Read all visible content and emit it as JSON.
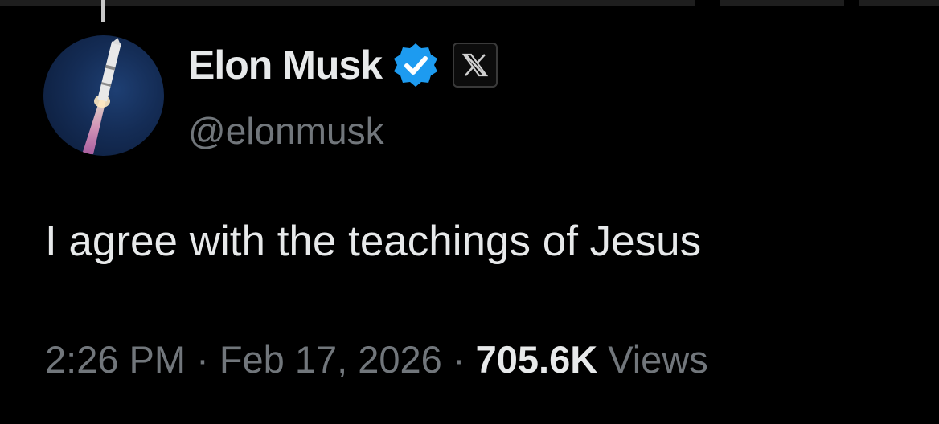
{
  "author": {
    "display_name": "Elon Musk",
    "handle": "@elonmusk",
    "verified": true,
    "affiliate_badge": "x-logo-icon",
    "avatar": "rocket-launch-avatar"
  },
  "tweet": {
    "text": "I agree with the teachings of Jesus",
    "time": "2:26 PM",
    "separator": "·",
    "date": "Feb 17, 2026",
    "views_count": "705.6K",
    "views_label": "Views"
  },
  "colors": {
    "background": "#000000",
    "primary_text": "#e7e9ea",
    "secondary_text": "#71767b",
    "verified_blue": "#1d9bf0"
  }
}
